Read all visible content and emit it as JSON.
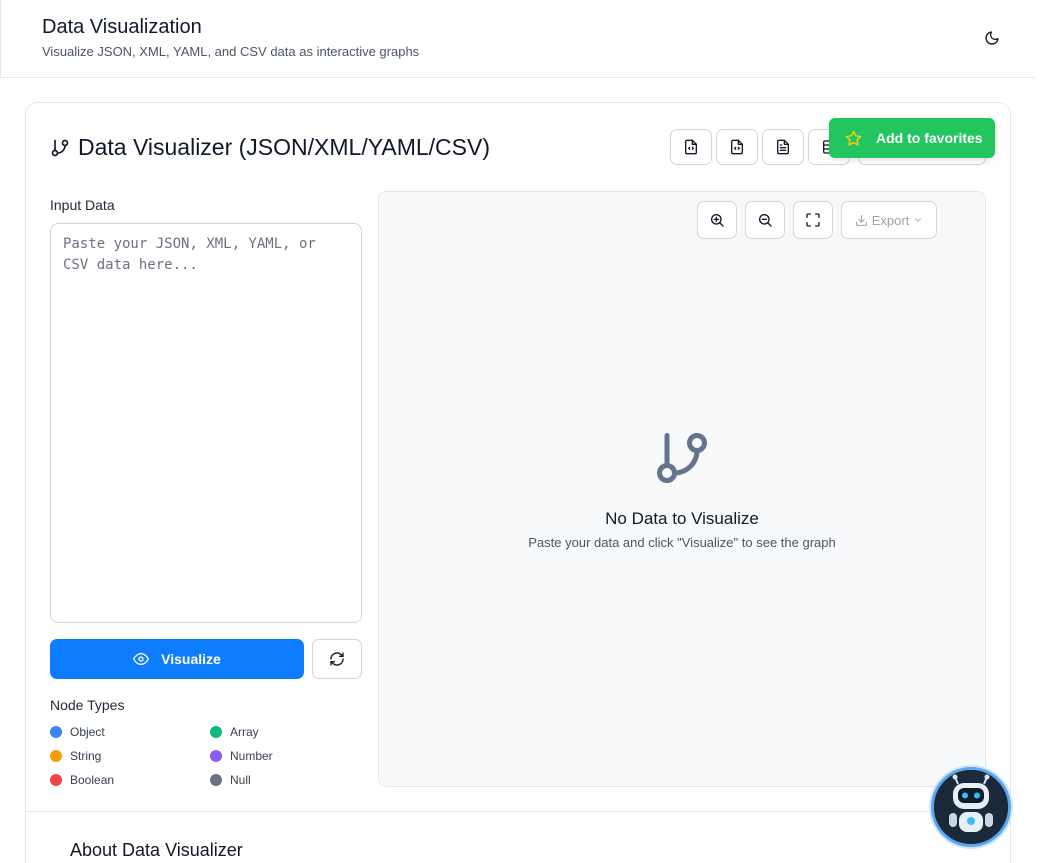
{
  "header": {
    "title": "Data Visualization",
    "subtitle": "Visualize JSON, XML, YAML, and CSV data as interactive graphs"
  },
  "card": {
    "title": "Data Visualizer (JSON/XML/YAML/CSV)",
    "favorites_label": "Add to favorites"
  },
  "input": {
    "label": "Input Data",
    "placeholder": "Paste your JSON, XML, YAML, or CSV data here...",
    "value": ""
  },
  "actions": {
    "visualize_label": "Visualize"
  },
  "legend": {
    "title": "Node Types",
    "items": [
      {
        "label": "Object",
        "color": "#3b82f6"
      },
      {
        "label": "Array",
        "color": "#10b981"
      },
      {
        "label": "String",
        "color": "#f59e0b"
      },
      {
        "label": "Number",
        "color": "#8b5cf6"
      },
      {
        "label": "Boolean",
        "color": "#ef4444"
      },
      {
        "label": "Null",
        "color": "#6b7280"
      }
    ]
  },
  "graph": {
    "export_label": "Export",
    "empty_title": "No Data to Visualize",
    "empty_subtitle": "Paste your data and click \"Visualize\" to see the graph"
  },
  "about": {
    "title": "About Data Visualizer"
  },
  "icons": {
    "theme": "moon-icon",
    "card_title": "git-branch-icon",
    "favorites": "star-icon",
    "visualize": "eye-icon",
    "reset": "refresh-icon",
    "zoom_in": "zoom-in-icon",
    "zoom_out": "zoom-out-icon",
    "fullscreen": "fullscreen-icon",
    "export": "download-icon"
  },
  "colors": {
    "primary": "#0d7cff",
    "success": "#22c55e",
    "panel_bg": "#f8f9fb"
  }
}
